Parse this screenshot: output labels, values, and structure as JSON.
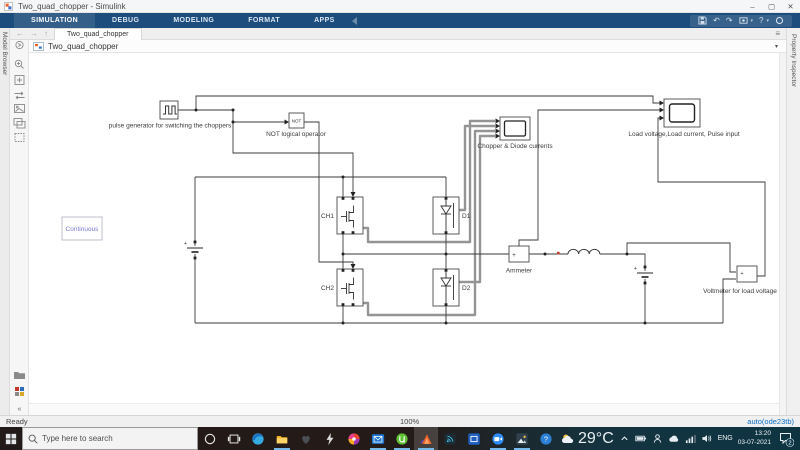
{
  "window": {
    "title": "Two_quad_chopper - Simulink"
  },
  "glyphs": {
    "minimize": "–",
    "maximize": "▢",
    "close": "✕",
    "back": "←",
    "forward": "→",
    "up": "↑",
    "menu": "≡",
    "caret": "▾",
    "collapse": "«",
    "undo": "↶",
    "redo": "↷",
    "help": "?",
    "plus": "+"
  },
  "ribbon": {
    "tabs": [
      "SIMULATION",
      "DEBUG",
      "MODELING",
      "FORMAT",
      "APPS"
    ]
  },
  "document_tab": "Two_quad_chopper",
  "breadcrumb": {
    "model": "Two_quad_chopper"
  },
  "side_panels": {
    "left": "Model Browser",
    "right": "Property Inspector"
  },
  "diagram": {
    "blocks": {
      "pulse_generator": {
        "label": "pulse generator for switching the choppers"
      },
      "not_operator": {
        "label": "NOT logical operator",
        "text": "NOT"
      },
      "scope_currents": {
        "label": "Chopper & Diode currents"
      },
      "scope_load": {
        "label": "Load voltage,Load current, Pulse input"
      },
      "powergui": {
        "label": "Continuous"
      },
      "ch1": {
        "label": "CH1"
      },
      "d1": {
        "label": "D1"
      },
      "ch2": {
        "label": "CH2"
      },
      "d2": {
        "label": "D2"
      },
      "ammeter": {
        "label": "Ammeter"
      },
      "voltmeter": {
        "label": "Voltmeter for load voltage"
      }
    }
  },
  "status_bar": {
    "ready": "Ready",
    "zoom": "100%",
    "solver": "auto(ode23tb)"
  },
  "taskbar": {
    "search_placeholder": "Type here to search",
    "weather_temp": "29°C",
    "language": "ENG",
    "time": "13:20",
    "date": "03-07-2021",
    "notification_count": "2"
  }
}
